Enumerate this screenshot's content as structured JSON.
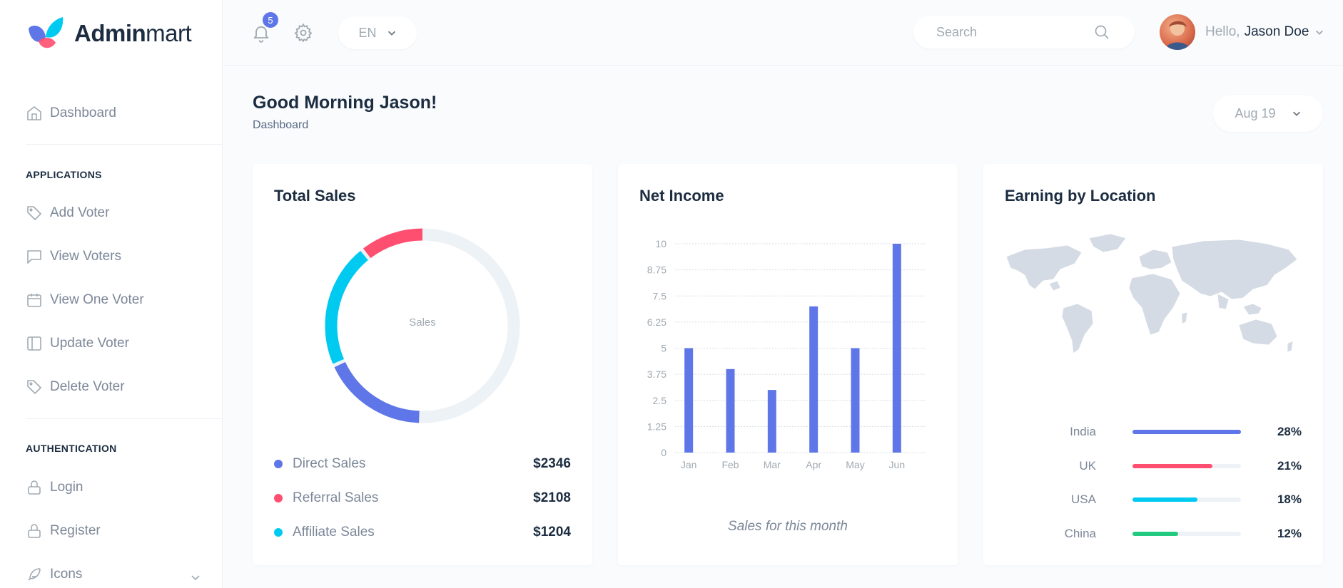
{
  "app": {
    "logo_bold": "Admin",
    "logo_light": "mart"
  },
  "sidebar": {
    "items_top": [
      {
        "label": "Dashboard",
        "icon": "home-icon"
      }
    ],
    "sections": [
      {
        "title": "APPLICATIONS",
        "items": [
          {
            "label": "Add Voter",
            "icon": "tag-icon"
          },
          {
            "label": "View Voters",
            "icon": "message-square-icon"
          },
          {
            "label": "View One Voter",
            "icon": "calendar-icon"
          },
          {
            "label": "Update Voter",
            "icon": "sidebar-layout-icon"
          },
          {
            "label": "Delete Voter",
            "icon": "tag-icon"
          }
        ]
      },
      {
        "title": "AUTHENTICATION",
        "items": [
          {
            "label": "Login",
            "icon": "lock-icon"
          },
          {
            "label": "Register",
            "icon": "lock-icon"
          },
          {
            "label": "Icons",
            "icon": "feather-icon"
          }
        ]
      }
    ]
  },
  "topbar": {
    "notification_count": "5",
    "language": "EN",
    "search_placeholder": "Search",
    "greeting_prefix": "Hello,",
    "user_name": "Jason Doe"
  },
  "page": {
    "title": "Good Morning Jason!",
    "breadcrumb": "Dashboard",
    "date_filter": "Aug 19"
  },
  "colors": {
    "primary": "#5f76e8",
    "danger": "#ff4f70",
    "cyan": "#01caf1",
    "success": "#22ca80",
    "track": "#edf2f6"
  },
  "cards": {
    "total_sales": {
      "title": "Total Sales",
      "center_label": "Sales",
      "legend": [
        {
          "label": "Direct Sales",
          "value": "$2346",
          "color": "#5f76e8"
        },
        {
          "label": "Referral Sales",
          "value": "$2108",
          "color": "#ff4f70"
        },
        {
          "label": "Affiliate Sales",
          "value": "$1204",
          "color": "#01caf1"
        }
      ]
    },
    "net_income": {
      "title": "Net Income",
      "caption": "Sales for this month"
    },
    "earning_by_location": {
      "title": "Earning by Location",
      "rows": [
        {
          "country": "India",
          "percent": "28%",
          "fill": 1.0,
          "color": "#5f76e8"
        },
        {
          "country": "UK",
          "percent": "21%",
          "fill": 0.74,
          "color": "#ff4f70"
        },
        {
          "country": "USA",
          "percent": "18%",
          "fill": 0.6,
          "color": "#01caf1"
        },
        {
          "country": "China",
          "percent": "12%",
          "fill": 0.42,
          "color": "#22ca80"
        }
      ]
    }
  },
  "chart_data": [
    {
      "type": "pie",
      "title": "Total Sales",
      "center_label": "Sales",
      "slices": [
        {
          "name": "Direct Sales",
          "value": 2346,
          "color": "#5f76e8",
          "shown_fraction": 0.18
        },
        {
          "name": "Referral Sales",
          "value": 2108,
          "color": "#ff4f70",
          "shown_fraction": 0.11
        },
        {
          "name": "Affiliate Sales",
          "value": 1204,
          "color": "#01caf1",
          "shown_fraction": 0.21
        }
      ],
      "remainder_color": "#edf2f6"
    },
    {
      "type": "bar",
      "title": "Net Income",
      "categories": [
        "Jan",
        "Feb",
        "Mar",
        "Apr",
        "May",
        "Jun"
      ],
      "values": [
        5,
        4,
        3,
        7,
        5,
        10
      ],
      "ylim": [
        0,
        10
      ],
      "yticks": [
        "0",
        "1.25",
        "2.5",
        "3.75",
        "5",
        "6.25",
        "7.5",
        "8.75",
        "10"
      ],
      "grid": true,
      "color": "#5f76e8"
    }
  ]
}
